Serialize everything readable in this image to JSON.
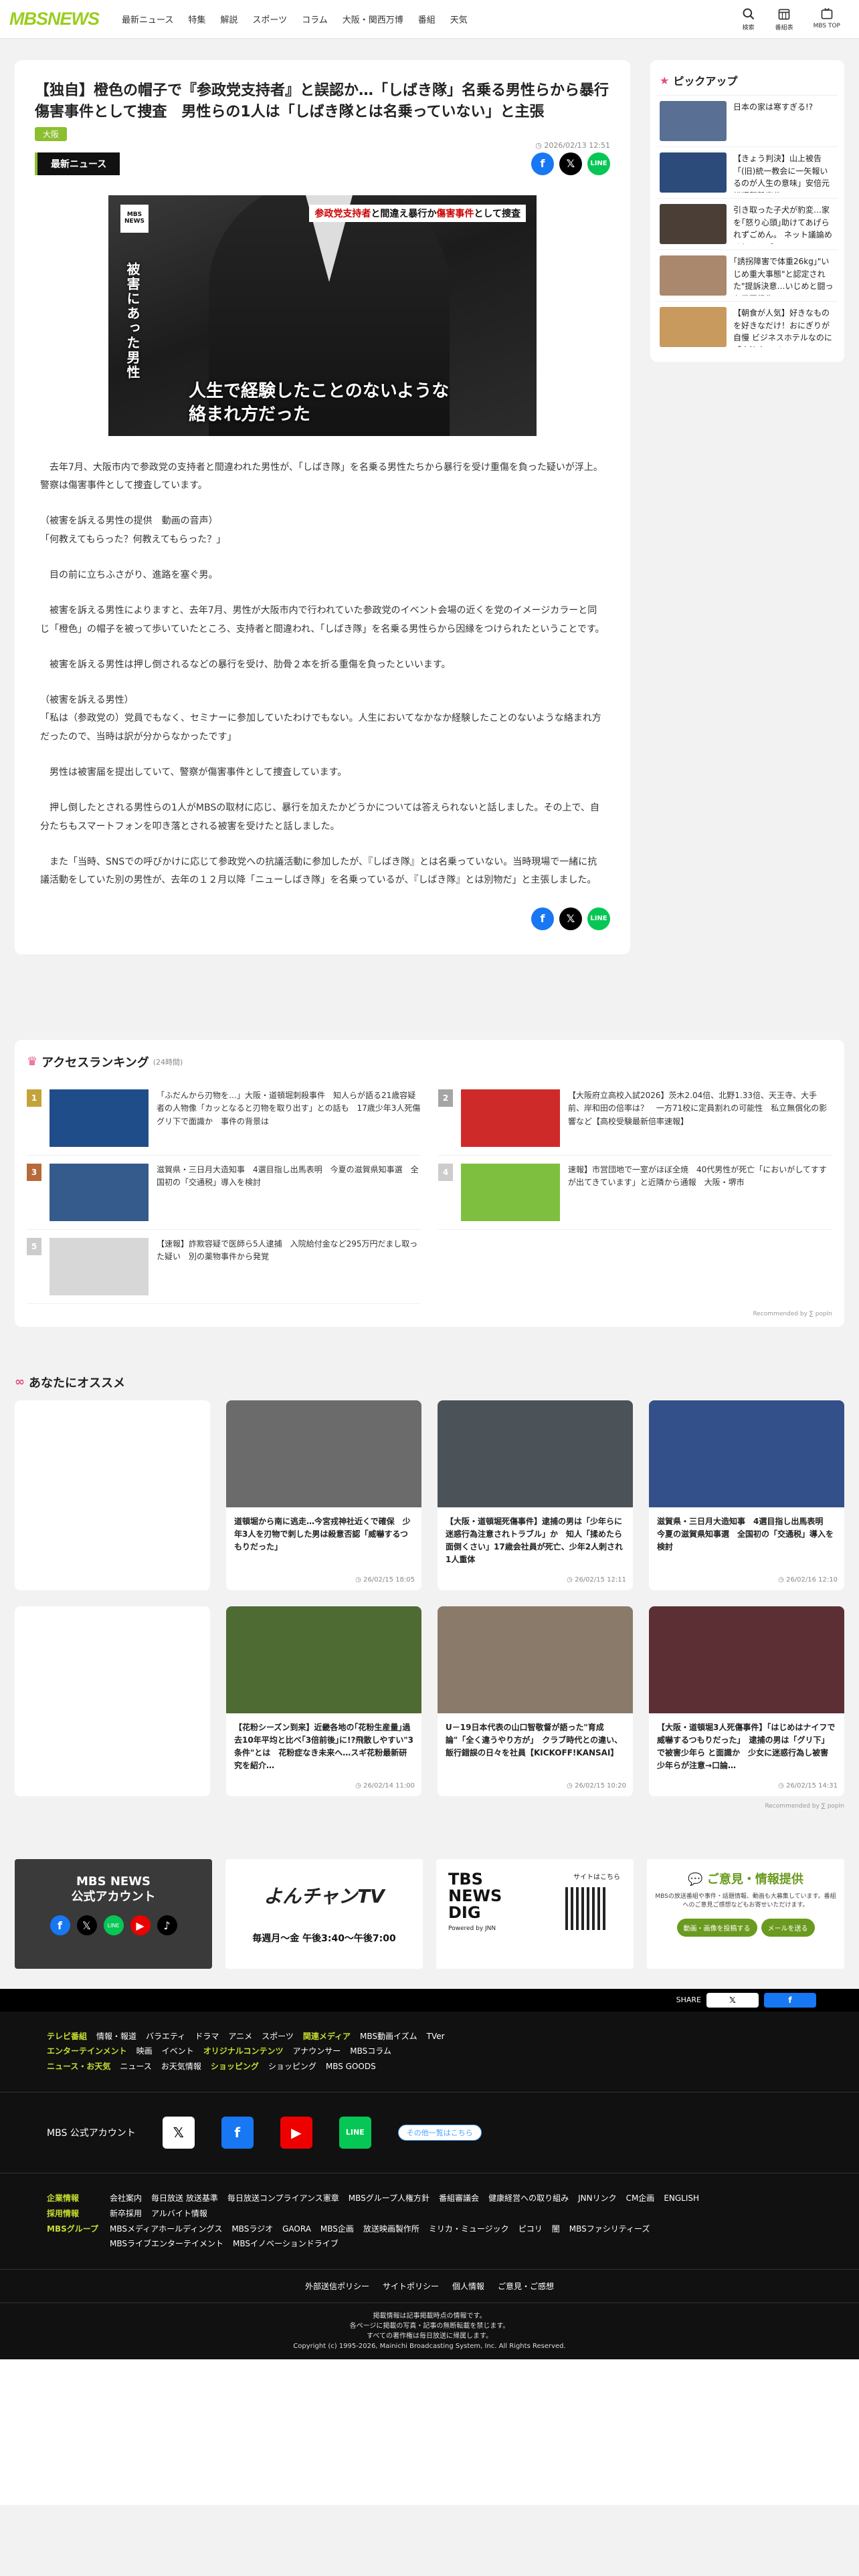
{
  "header": {
    "logo": "MBSNEWS",
    "nav": [
      "最新ニュース",
      "特集",
      "解説",
      "スポーツ",
      "コラム",
      "大阪・関西万博",
      "番組",
      "天気"
    ],
    "icons": [
      {
        "name": "search-icon",
        "label": "検索"
      },
      {
        "name": "program-icon",
        "label": "番組表"
      },
      {
        "name": "top-icon",
        "label": "MBS TOP"
      }
    ]
  },
  "article": {
    "title": "【独自】橙色の帽子で『参政党支持者』と誤認か…「しばき隊」名乗る男性らから暴行　傷害事件として捜査　男性らの1人は「しばき隊とは名乗っていない」と主張",
    "tag": "大阪",
    "date": "2026/02/13 12:51",
    "badge": "最新ニュース",
    "hero": {
      "logo_text": "MBS NEWS",
      "top_caption_red": "参政党支持者",
      "top_caption_black": "と間違え暴行か",
      "top_caption_red2": "傷害事件",
      "top_caption_black2": "として捜査",
      "vertical": "被害にあった男性",
      "caption_line1": "人生で経験したことのないような",
      "caption_line2": "絡まれ方だった"
    },
    "paragraphs": [
      "　去年7月、大阪市内で参政党の支持者と間違われた男性が、「しばき隊」を名乗る男性たちから暴行を受け重傷を負った疑いが浮上。警察は傷害事件として捜査しています。",
      "（被害を訴える男性の提供　動画の音声）\n「何教えてもらった？何教えてもらった？」",
      "　目の前に立ちふさがり、進路を塞ぐ男。",
      "　被害を訴える男性によりますと、去年7月、男性が大阪市内で行われていた参政党のイベント会場の近くを党のイメージカラーと同じ「橙色」の帽子を被って歩いていたところ、支持者と間違われ、「しばき隊」を名乗る男性らから因縁をつけられたということです。",
      "　被害を訴える男性は押し倒されるなどの暴行を受け、肋骨２本を折る重傷を負ったといいます。",
      "（被害を訴える男性）\n「私は（参政党の）党員でもなく、セミナーに参加していたわけでもない。人生においてなかなか経験したことのないような絡まれ方だったので、当時は訳が分からなかったです」",
      "　男性は被害届を提出していて、警察が傷害事件として捜査しています。",
      "　押し倒したとされる男性らの1人がMBSの取材に応じ、暴行を加えたかどうかについては答えられないと話しました。その上で、自分たちもスマートフォンを叩き落とされる被害を受けたと話しました。",
      "　また「当時、SNSでの呼びかけに応じて参政党への抗議活動に参加したが、『しばき隊』とは名乗っていない。当時現場で一緒に抗議活動をしていた別の男性が、去年の１２月以降「ニューしばき隊」を名乗っているが、『しばき隊』とは別物だ」と主張しました。"
    ]
  },
  "sidebar": {
    "title": "ピックアップ",
    "items": [
      {
        "text": "日本の家は寒すぎる!?",
        "color": "#5a6f94"
      },
      {
        "text": "【きょう判決】山上被告「(旧)統一教会に一矢報いるのが人生の意味」安倍元総理襲撃事件…",
        "color": "#2c4b7b"
      },
      {
        "text": "引き取った子犬が豹変…家を｢怒り心頭｣助けてあげられずごめん。 ネット議論めぐりトラブル…",
        "color": "#4a3e36"
      },
      {
        "text": "｢誘拐障害で体重26kg｣\"いじめ重大事態\"と認定された\"提訴決意…いじめと闘った元同級生…",
        "color": "#a9886d"
      },
      {
        "text": "【朝食が人気】好きなものを好きなだけ！おにぎりが自慢 ビジネスホテルなのに「宿泊客」以…",
        "color": "#c99a5e"
      }
    ]
  },
  "ranking": {
    "title": "アクセスランキング",
    "period": "(24時間)",
    "items": [
      {
        "rank": "1",
        "text": "「ふだんから刃物を…」大阪・道頓堀刺殺事件　知人らが語る21歳容疑者の人物像「カッとなると刃物を取り出す」との話も　17歳少年3人死傷　グリ下で面識か　事件の背景は",
        "color": "#1f4d8a"
      },
      {
        "rank": "2",
        "text": "【大阪府立高校入試2026】茨木2.04倍、北野1.33倍、天王寺、大手前、岸和田の倍率は？　一方71校に定員割れの可能性　私立無償化の影響など【高校受験最新倍率速報】",
        "color": "#cf2a2a"
      },
      {
        "rank": "3",
        "text": "滋賀県・三日月大造知事　4選目指し出馬表明　今夏の滋賀県知事選　全国初の「交通税」導入を検討",
        "color": "#355a8c"
      },
      {
        "rank": "4",
        "text": "速報】市営団地で一室がほぼ全焼　40代男性が死亡「においがしてすすが出てきています」と近隣から通報　大阪・堺市",
        "color": "#7fbf3f"
      },
      {
        "rank": "5",
        "text": "【速報】詐欺容疑で医師ら5人逮捕　入院給付金など295万円だまし取った疑い　別の薬物事件から発覚",
        "color": "#d7d7d7"
      }
    ],
    "recommended_by": "Recommended by"
  },
  "recommend": {
    "title": "あなたにオススメ",
    "cards": [
      {
        "text": "",
        "date": "",
        "color": "#ffffff"
      },
      {
        "text": "道頓堀から南に逃走…今宮戎神社近くで確保　少年3人を刃物で刺した男は殺意否認「威嚇するつもりだった」",
        "date": "26/02/15 18:05",
        "color": "#6b6b6b"
      },
      {
        "text": "【大阪・道頓堀死傷事件】逮捕の男は「少年らに迷惑行為注意されトラブル」か　知人「揉めたら面倒くさい」17歳会社員が死亡、少年2人刺され1人重体",
        "date": "26/02/15 12:11",
        "color": "#4b5358"
      },
      {
        "text": "滋賀県・三日月大造知事　4選目指し出馬表明　今夏の滋賀県知事選　全国初の「交通税」導入を検討",
        "date": "26/02/16 12:10",
        "color": "#34508a"
      },
      {
        "text": "",
        "date": "",
        "color": "#ffffff"
      },
      {
        "text": "【花粉シーズン到来】近畿各地の｢花粉生産量｣過去10年平均と比べ｢3倍前後｣に!?飛散しやすい\"3条件\"とは　花粉症なき未来へ…スギ花粉最新研究を紹介…",
        "date": "26/02/14 11:00",
        "color": "#4f6b34"
      },
      {
        "text": "U－19日本代表の山口智敬督が語った\"育成論\"「全く違うやり方が」　クラブ時代との違い、飯行錯誤の日々を社員【KICKOFF!KANSAI】",
        "date": "26/02/15 10:20",
        "color": "#8a7a6a"
      },
      {
        "text": "【大阪・道頓堀3人死傷事件】「はじめはナイフで威嚇するつもりだった」　逮捕の男は「グリ下」で被害少年ら と面識か　少女に迷惑行為し被害少年らが注意→口論…",
        "date": "26/02/15 14:31",
        "color": "#5c2f34"
      }
    ],
    "recommended_by": "Recommended by"
  },
  "banners": {
    "official": "MBS NEWS\n公式アカウント",
    "yonchan": "よんチャンTV",
    "yonchan_time": "毎週月～金 午後3:40～午後7:00",
    "tbs": "TBS NEWS DIG",
    "tbs_sub": "Powered by JNN",
    "tbs_app": "サイトはこちら",
    "info_title": "ご意見・情報提供",
    "info_text": "MBSの放送番組や事件・話題情報、動画も大募集しています。番組へのご意見ご感想などもお寄せいただけます。",
    "info_btn1": "動画・画像を投稿する",
    "info_btn2": "メールを送る"
  },
  "footer": {
    "share_label": "SHARE",
    "rows1": [
      {
        "label": "テレビ番組",
        "items": [
          "情報・報道",
          "バラエティ",
          "ドラマ",
          "アニメ",
          "スポーツ"
        ],
        "label2": "関連メディア",
        "items2": [
          "MBS動画イズム",
          "TVer"
        ]
      },
      {
        "label": "エンターテインメント",
        "items": [
          "映画",
          "イベント"
        ],
        "label2": "オリジナルコンテンツ",
        "items2": [
          "アナウンサー",
          "MBSコラム"
        ]
      },
      {
        "label": "ニュース・お天気",
        "items": [
          "ニュース",
          "お天気情報"
        ],
        "label2": "ショッピング",
        "items2": [
          "ショッピング",
          "MBS GOODS"
        ]
      }
    ],
    "official_account": "MBS 公式アカウント",
    "official_more": "その他一覧はこちら",
    "rows2": [
      {
        "label": "企業情報",
        "items": [
          "会社案内",
          "毎日放送 放送基準",
          "毎日放送コンプライアンス憲章",
          "MBSグループ人権方針",
          "番組審議会",
          "健康経営への取り組み",
          "JNNリンク",
          "CM企画",
          "ENGLISH"
        ]
      },
      {
        "label": "採用情報",
        "items": [
          "新卒採用",
          "アルバイト情報"
        ]
      },
      {
        "label": "MBSグループ",
        "items": [
          "MBSメディアホールディングス",
          "MBSラジオ",
          "GAORA",
          "MBS企画",
          "放送映画製作所",
          "ミリカ・ミュージック",
          "ピコリ",
          "闇",
          "MBSファシリティーズ"
        ]
      },
      {
        "label": "",
        "items": [
          "MBSライブエンターテイメント",
          "MBSイノベーションドライブ"
        ]
      }
    ],
    "links": [
      "外部送信ポリシー",
      "サイトポリシー",
      "個人情報",
      "ご意見・ご感想"
    ],
    "copy1": "掲載情報は記事掲載時点の情報です。",
    "copy2": "各ページに掲載の写真・記事の無断転載を禁じます。",
    "copy3": "すべての著作権は毎日放送に帰属します。",
    "copy4": "Copyright (c) 1995-2026, Mainichi Broadcasting System, Inc. All Rights Reserved."
  }
}
